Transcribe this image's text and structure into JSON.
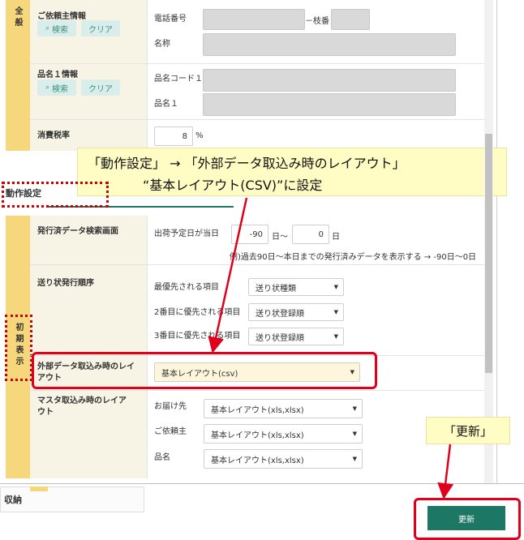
{
  "general": {
    "side_label": "全般",
    "requester": {
      "title": "ご依頼主情報",
      "search": "検索",
      "clear": "クリア",
      "phone_label": "電話番号",
      "branch_label": "－枝番",
      "name_label": "名称"
    },
    "item1": {
      "title": "品名１情報",
      "search": "検索",
      "clear": "クリア",
      "code_label": "品名コード１",
      "name_label": "品名１"
    },
    "tax": {
      "title": "消費税率",
      "value": "8",
      "unit": "%"
    }
  },
  "callout_top": {
    "line1": "「動作設定」 → 「外部データ取込み時のレイアウト」",
    "line2": "“基本レイアウト(CSV)”に設定"
  },
  "operation_heading": "動作設定",
  "initial": {
    "side_label": "初期表示",
    "issued_search": {
      "title": "発行済データ検索画面",
      "ship_label": "出荷予定日が当日",
      "from_value": "-90",
      "from_unit": "日～",
      "to_value": "0",
      "to_unit": "日",
      "note": "例)過去90日～本日までの発行済みデータを表示する → -90日～0日"
    },
    "order": {
      "title": "送り状発行順序",
      "priority1_label": "最優先される項目",
      "priority1_value": "送り状種類",
      "priority2_label": "2番目に優先される項目",
      "priority2_value": "送り状登録順",
      "priority3_label": "3番目に優先される項目",
      "priority3_value": "送り状登録順"
    },
    "external": {
      "title": "外部データ取込み時のレイアウト",
      "value": "基本レイアウト(csv)"
    },
    "master": {
      "title": "マスタ取込み時のレイアウト",
      "dest_label": "お届け先",
      "dest_value": "基本レイアウト(xls,xlsx)",
      "req_label": "ご依頼主",
      "req_value": "基本レイアウト(xls,xlsx)",
      "item_label": "品名",
      "item_value": "基本レイアウト(xls,xlsx)"
    }
  },
  "bottom_fragment": "収納",
  "callout_update": "「更新」",
  "update_button": "更新"
}
